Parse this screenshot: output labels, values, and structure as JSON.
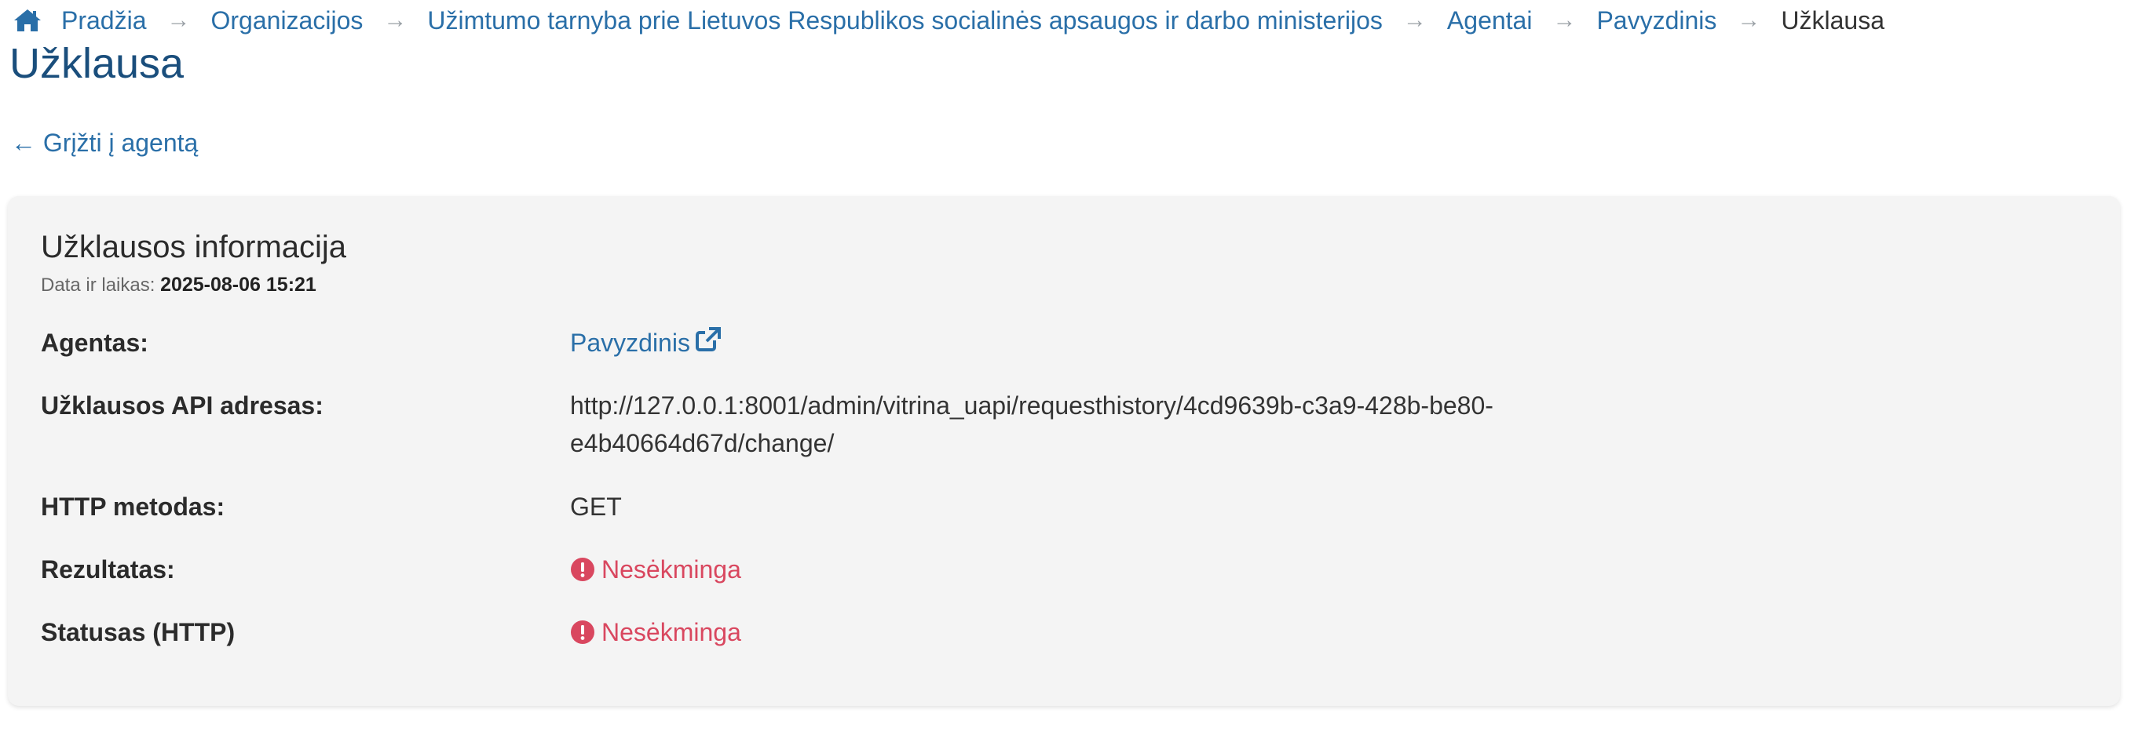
{
  "breadcrumb": {
    "home": "Pradžia",
    "items": [
      "Organizacijos",
      "Užimtumo tarnyba prie Lietuvos Respublikos socialinės apsaugos ir darbo ministerijos",
      "Agentai",
      "Pavyzdinis"
    ],
    "current": "Užklausa",
    "separator": "→"
  },
  "page": {
    "title": "Užklausa",
    "back_link": "← Grįžti į agentą"
  },
  "card": {
    "title": "Užklausos informacija",
    "datetime_label": "Data ir laikas:",
    "datetime_value": "2025-08-06 15:21",
    "rows": {
      "agent": {
        "label": "Agentas:",
        "value": "Pavyzdinis"
      },
      "api_url": {
        "label": "Užklausos API adresas:",
        "value": "http://127.0.0.1:8001/admin/vitrina_uapi/requesthistory/4cd9639b-c3a9-428b-be80-e4b40664d67d/change/"
      },
      "http_method": {
        "label": "HTTP metodas:",
        "value": "GET"
      },
      "result": {
        "label": "Rezultatas:",
        "value": "Nesėkminga"
      },
      "http_status": {
        "label": "Statusas (HTTP)",
        "value": "Nesėkminga"
      }
    }
  },
  "colors": {
    "link": "#2a6fa8",
    "title": "#1a4e7c",
    "error": "#d9475f",
    "card_bg": "#f4f4f4"
  },
  "icons": {
    "home": "home-icon",
    "external": "external-link-icon",
    "alert": "exclamation-circle-icon"
  }
}
